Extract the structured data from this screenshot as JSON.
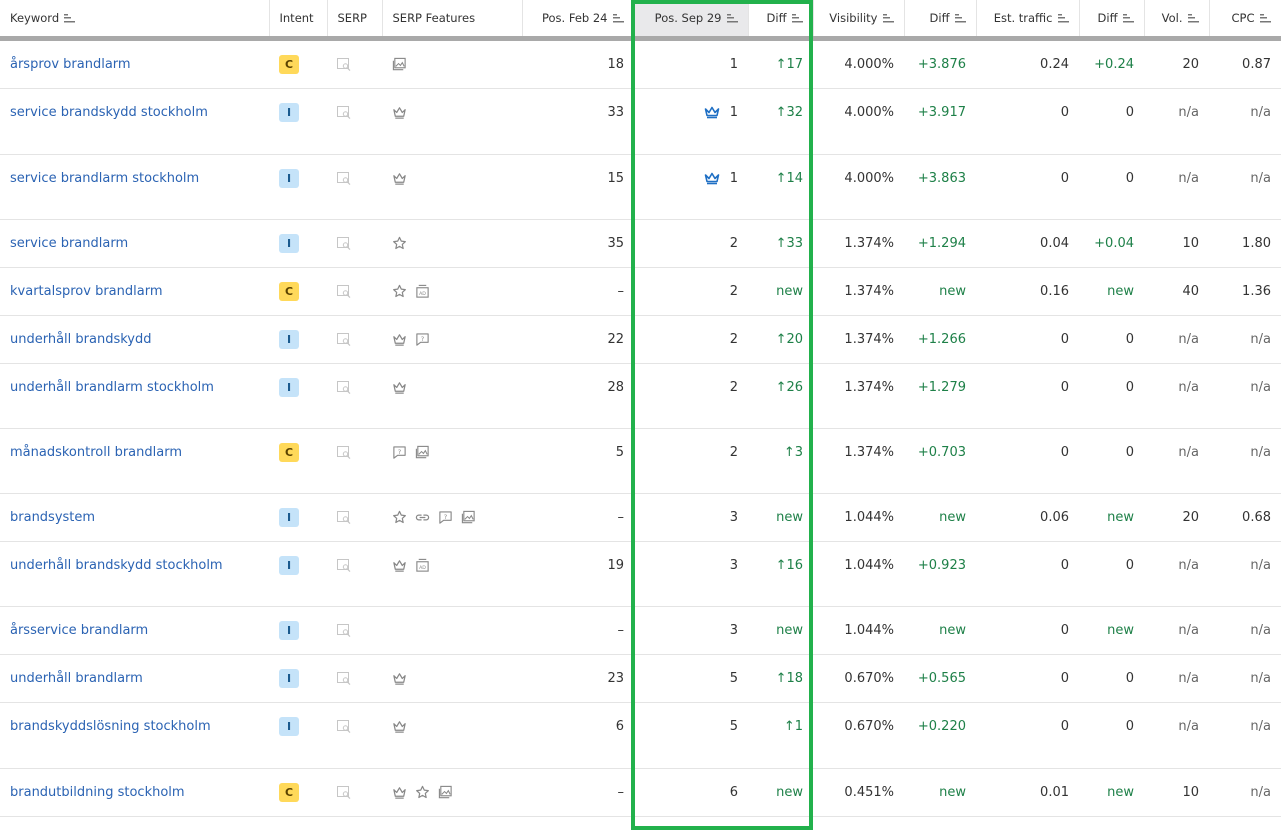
{
  "columns": {
    "keyword": "Keyword",
    "intent": "Intent",
    "serp": "SERP",
    "serp_features": "SERP Features",
    "pos_feb": "Pos. Feb 24",
    "pos_sep": "Pos. Sep 29",
    "diff_pos": "Diff",
    "visibility": "Visibility",
    "diff_vis": "Diff",
    "traffic": "Est. traffic",
    "diff_traffic": "Diff",
    "vol": "Vol.",
    "cpc": "CPC"
  },
  "colors": {
    "link": "#2b63b3",
    "positive": "#1e8048",
    "highlight": "#22b14c"
  },
  "rows": [
    {
      "keyword": "årsprov brandlarm",
      "intent": "C",
      "features": [
        "image-pack-icon"
      ],
      "crown": false,
      "pos_feb": "18",
      "pos_sep": "1",
      "diff": "↑17",
      "vis": "4.000%",
      "vis_diff": "+3.876",
      "traffic": "0.24",
      "traffic_diff": "+0.24",
      "vol": "20",
      "cpc": "0.87",
      "h": 47
    },
    {
      "keyword": "service brandskydd stockholm",
      "intent": "I",
      "features": [
        "crown-icon"
      ],
      "crown": true,
      "pos_feb": "33",
      "pos_sep": "1",
      "diff": "↑32",
      "vis": "4.000%",
      "vis_diff": "+3.917",
      "traffic": "0",
      "traffic_diff": "0",
      "vol": "n/a",
      "cpc": "n/a",
      "h": 66
    },
    {
      "keyword": "service brandlarm stockholm",
      "intent": "I",
      "features": [
        "crown-icon"
      ],
      "crown": true,
      "pos_feb": "15",
      "pos_sep": "1",
      "diff": "↑14",
      "vis": "4.000%",
      "vis_diff": "+3.863",
      "traffic": "0",
      "traffic_diff": "0",
      "vol": "n/a",
      "cpc": "n/a",
      "h": 65
    },
    {
      "keyword": "service brandlarm",
      "intent": "I",
      "features": [
        "star-icon"
      ],
      "crown": false,
      "pos_feb": "35",
      "pos_sep": "2",
      "diff": "↑33",
      "vis": "1.374%",
      "vis_diff": "+1.294",
      "traffic": "0.04",
      "traffic_diff": "+0.04",
      "vol": "10",
      "cpc": "1.80",
      "h": 47
    },
    {
      "keyword": "kvartalsprov brandlarm",
      "intent": "C",
      "features": [
        "star-icon",
        "ad-icon"
      ],
      "crown": false,
      "pos_feb": "–",
      "pos_sep": "2",
      "diff": "new",
      "vis": "1.374%",
      "vis_diff": "new",
      "traffic": "0.16",
      "traffic_diff": "new",
      "vol": "40",
      "cpc": "1.36",
      "h": 47
    },
    {
      "keyword": "underhåll brandskydd",
      "intent": "I",
      "features": [
        "crown-icon",
        "question-icon"
      ],
      "crown": false,
      "pos_feb": "22",
      "pos_sep": "2",
      "diff": "↑20",
      "vis": "1.374%",
      "vis_diff": "+1.266",
      "traffic": "0",
      "traffic_diff": "0",
      "vol": "n/a",
      "cpc": "n/a",
      "h": 47
    },
    {
      "keyword": "underhåll brandlarm stockholm",
      "intent": "I",
      "features": [
        "crown-icon"
      ],
      "crown": false,
      "pos_feb": "28",
      "pos_sep": "2",
      "diff": "↑26",
      "vis": "1.374%",
      "vis_diff": "+1.279",
      "traffic": "0",
      "traffic_diff": "0",
      "vol": "n/a",
      "cpc": "n/a",
      "h": 65
    },
    {
      "keyword": "månadskontroll brandlarm",
      "intent": "C",
      "features": [
        "question-icon",
        "image-pack-icon"
      ],
      "crown": false,
      "pos_feb": "5",
      "pos_sep": "2",
      "diff": "↑3",
      "vis": "1.374%",
      "vis_diff": "+0.703",
      "traffic": "0",
      "traffic_diff": "0",
      "vol": "n/a",
      "cpc": "n/a",
      "h": 65
    },
    {
      "keyword": "brandsystem",
      "intent": "I",
      "features": [
        "star-icon",
        "link-icon",
        "question-icon",
        "image-pack-icon"
      ],
      "crown": false,
      "pos_feb": "–",
      "pos_sep": "3",
      "diff": "new",
      "vis": "1.044%",
      "vis_diff": "new",
      "traffic": "0.06",
      "traffic_diff": "new",
      "vol": "20",
      "cpc": "0.68",
      "h": 47
    },
    {
      "keyword": "underhåll brandskydd stockholm",
      "intent": "I",
      "features": [
        "crown-icon",
        "ad-icon"
      ],
      "crown": false,
      "pos_feb": "19",
      "pos_sep": "3",
      "diff": "↑16",
      "vis": "1.044%",
      "vis_diff": "+0.923",
      "traffic": "0",
      "traffic_diff": "0",
      "vol": "n/a",
      "cpc": "n/a",
      "h": 65
    },
    {
      "keyword": "årsservice brandlarm",
      "intent": "I",
      "features": [],
      "crown": false,
      "pos_feb": "–",
      "pos_sep": "3",
      "diff": "new",
      "vis": "1.044%",
      "vis_diff": "new",
      "traffic": "0",
      "traffic_diff": "new",
      "vol": "n/a",
      "cpc": "n/a",
      "h": 47
    },
    {
      "keyword": "underhåll brandlarm",
      "intent": "I",
      "features": [
        "crown-icon"
      ],
      "crown": false,
      "pos_feb": "23",
      "pos_sep": "5",
      "diff": "↑18",
      "vis": "0.670%",
      "vis_diff": "+0.565",
      "traffic": "0",
      "traffic_diff": "0",
      "vol": "n/a",
      "cpc": "n/a",
      "h": 47
    },
    {
      "keyword": "brandskyddslösning stockholm",
      "intent": "I",
      "features": [
        "crown-icon"
      ],
      "crown": false,
      "pos_feb": "6",
      "pos_sep": "5",
      "diff": "↑1",
      "vis": "0.670%",
      "vis_diff": "+0.220",
      "traffic": "0",
      "traffic_diff": "0",
      "vol": "n/a",
      "cpc": "n/a",
      "h": 66
    },
    {
      "keyword": "brandutbildning stockholm",
      "intent": "C",
      "features": [
        "crown-icon",
        "star-icon",
        "image-pack-icon"
      ],
      "crown": false,
      "pos_feb": "–",
      "pos_sep": "6",
      "diff": "new",
      "vis": "0.451%",
      "vis_diff": "new",
      "traffic": "0.01",
      "traffic_diff": "new",
      "vol": "10",
      "cpc": "n/a",
      "h": 47
    }
  ]
}
